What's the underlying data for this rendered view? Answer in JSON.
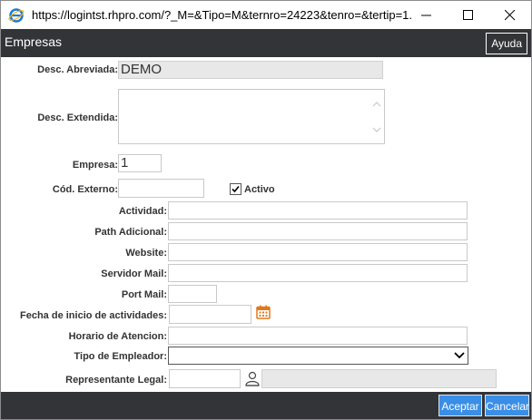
{
  "window": {
    "url": "https://logintst.rhpro.com/?_M=&Tipo=M&ternro=24223&tenro=&tertip=1..."
  },
  "header": {
    "title": "Empresas",
    "help_label": "Ayuda"
  },
  "form": {
    "desc_abreviada": {
      "label": "Desc. Abreviada:",
      "value": "DEMO"
    },
    "desc_extendida": {
      "label": "Desc. Extendida:",
      "value": ""
    },
    "empresa": {
      "label": "Empresa:",
      "value": "1"
    },
    "cod_externo": {
      "label": "Cód. Externo:",
      "value": ""
    },
    "activo": {
      "label": "Activo",
      "checked": true
    },
    "actividad": {
      "label": "Actividad:",
      "value": ""
    },
    "path_adicional": {
      "label": "Path Adicional:",
      "value": ""
    },
    "website": {
      "label": "Website:",
      "value": ""
    },
    "servidor_mail": {
      "label": "Servidor Mail:",
      "value": ""
    },
    "port_mail": {
      "label": "Port Mail:",
      "value": ""
    },
    "fecha_inicio": {
      "label": "Fecha de inicio de actividades:",
      "value": ""
    },
    "horario_atencion": {
      "label": "Horario de Atencion:",
      "value": ""
    },
    "tipo_empleador": {
      "label": "Tipo de Empleador:",
      "value": ""
    },
    "representante_legal": {
      "label": "Representante Legal:",
      "value": "",
      "name_value": ""
    }
  },
  "footer": {
    "accept_label": "Aceptar",
    "cancel_label": "Cancelar"
  },
  "colors": {
    "header_bg": "#333438",
    "button_blue": "#3a8ee6",
    "calendar_orange": "#e07a1c"
  }
}
